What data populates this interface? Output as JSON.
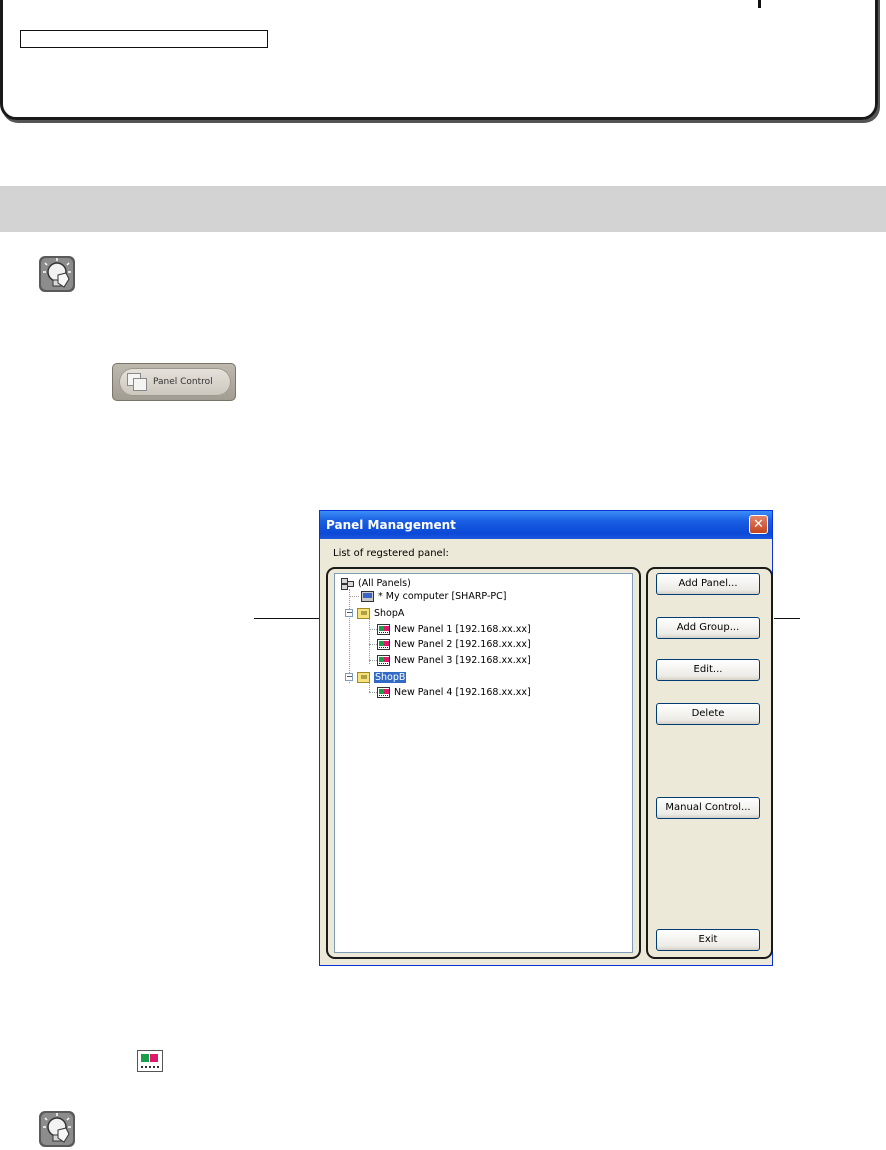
{
  "panel_control_button": {
    "label": "Panel Control"
  },
  "dialog": {
    "title": "Panel Management",
    "close_symbol": "✕",
    "list_label": "List of regstered panel:",
    "tree": [
      {
        "label": "(All Panels)",
        "icon": "all-panels-icon"
      },
      {
        "label": "* My computer [SHARP-PC]",
        "icon": "computer-icon"
      },
      {
        "label": "ShopA",
        "icon": "folder-icon"
      },
      {
        "label": "New Panel 1 [192.168.xx.xx]",
        "icon": "panel-icon"
      },
      {
        "label": "New Panel 2 [192.168.xx.xx]",
        "icon": "panel-icon"
      },
      {
        "label": "New Panel 3 [192.168.xx.xx]",
        "icon": "panel-icon"
      },
      {
        "label": "ShopB",
        "icon": "folder-icon",
        "selected": true
      },
      {
        "label": "New Panel 4 [192.168.xx.xx]",
        "icon": "panel-icon"
      }
    ],
    "buttons": {
      "add_panel": "Add Panel...",
      "add_group": "Add Group...",
      "edit": "Edit...",
      "delete": "Delete",
      "manual_control": "Manual Control...",
      "exit": "Exit"
    }
  },
  "colors": {
    "titlebar": "#0b49d6",
    "dialog_bg": "#ece9d8",
    "selection": "#316ac5",
    "heading_band": "#d3d3d3"
  }
}
